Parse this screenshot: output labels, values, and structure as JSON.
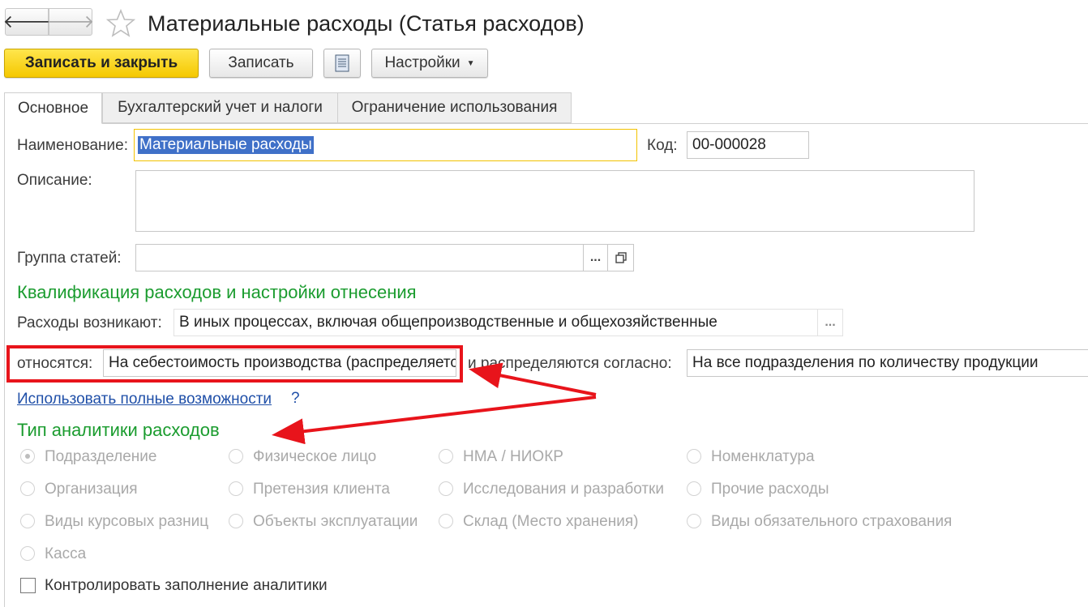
{
  "window": {
    "title": "Материальные расходы (Статья расходов)"
  },
  "toolbar": {
    "back_icon": "arrow-left-icon",
    "forward_icon": "arrow-right-icon",
    "favorite_icon": "star-icon",
    "save_close_label": "Записать и закрыть",
    "save_label": "Записать",
    "settings_label": "Настройки",
    "primary_color": "#f5c800"
  },
  "tabs": [
    {
      "label": "Основное",
      "active": true
    },
    {
      "label": "Бухгалтерский учет и налоги",
      "active": false
    },
    {
      "label": "Ограничение использования",
      "active": false
    }
  ],
  "form": {
    "name_label": "Наименование:",
    "name_value": "Материальные расходы",
    "code_label": "Код:",
    "code_value": "00-000028",
    "description_label": "Описание:",
    "description_value": "",
    "group_label": "Группа статей:",
    "group_value": "",
    "group_select_label": "...",
    "section1_title": "Квалификация расходов и настройки отнесения",
    "arise_label": "Расходы возникают:",
    "arise_value": "В иных процессах, включая общепроизводственные и общехозяйственные",
    "arise_select_label": "...",
    "relate_label": "относятся:",
    "relate_value": "На себестоимость производства (распределяется)",
    "distribute_label": "и распределяются согласно:",
    "distribute_value": "На все подразделения по количеству продукции",
    "full_link": "Использовать полные возможности",
    "help_label": "?",
    "section2_title": "Тип аналитики расходов",
    "radios": [
      [
        "Подразделение",
        "Физическое лицо",
        "НМА / НИОКР",
        "Номенклатура"
      ],
      [
        "Организация",
        "Претензия клиента",
        "Исследования и разработки",
        "Прочие расходы"
      ],
      [
        "Виды курсовых разниц",
        "Объекты эксплуатации",
        "Склад (Место хранения)",
        "Виды обязательного страхования"
      ],
      [
        "Касса"
      ]
    ],
    "selected_radio": "Подразделение",
    "checkbox_label": "Контролировать заполнение аналитики",
    "checkbox_checked": false
  },
  "annotation": {
    "color": "#e8141b"
  }
}
